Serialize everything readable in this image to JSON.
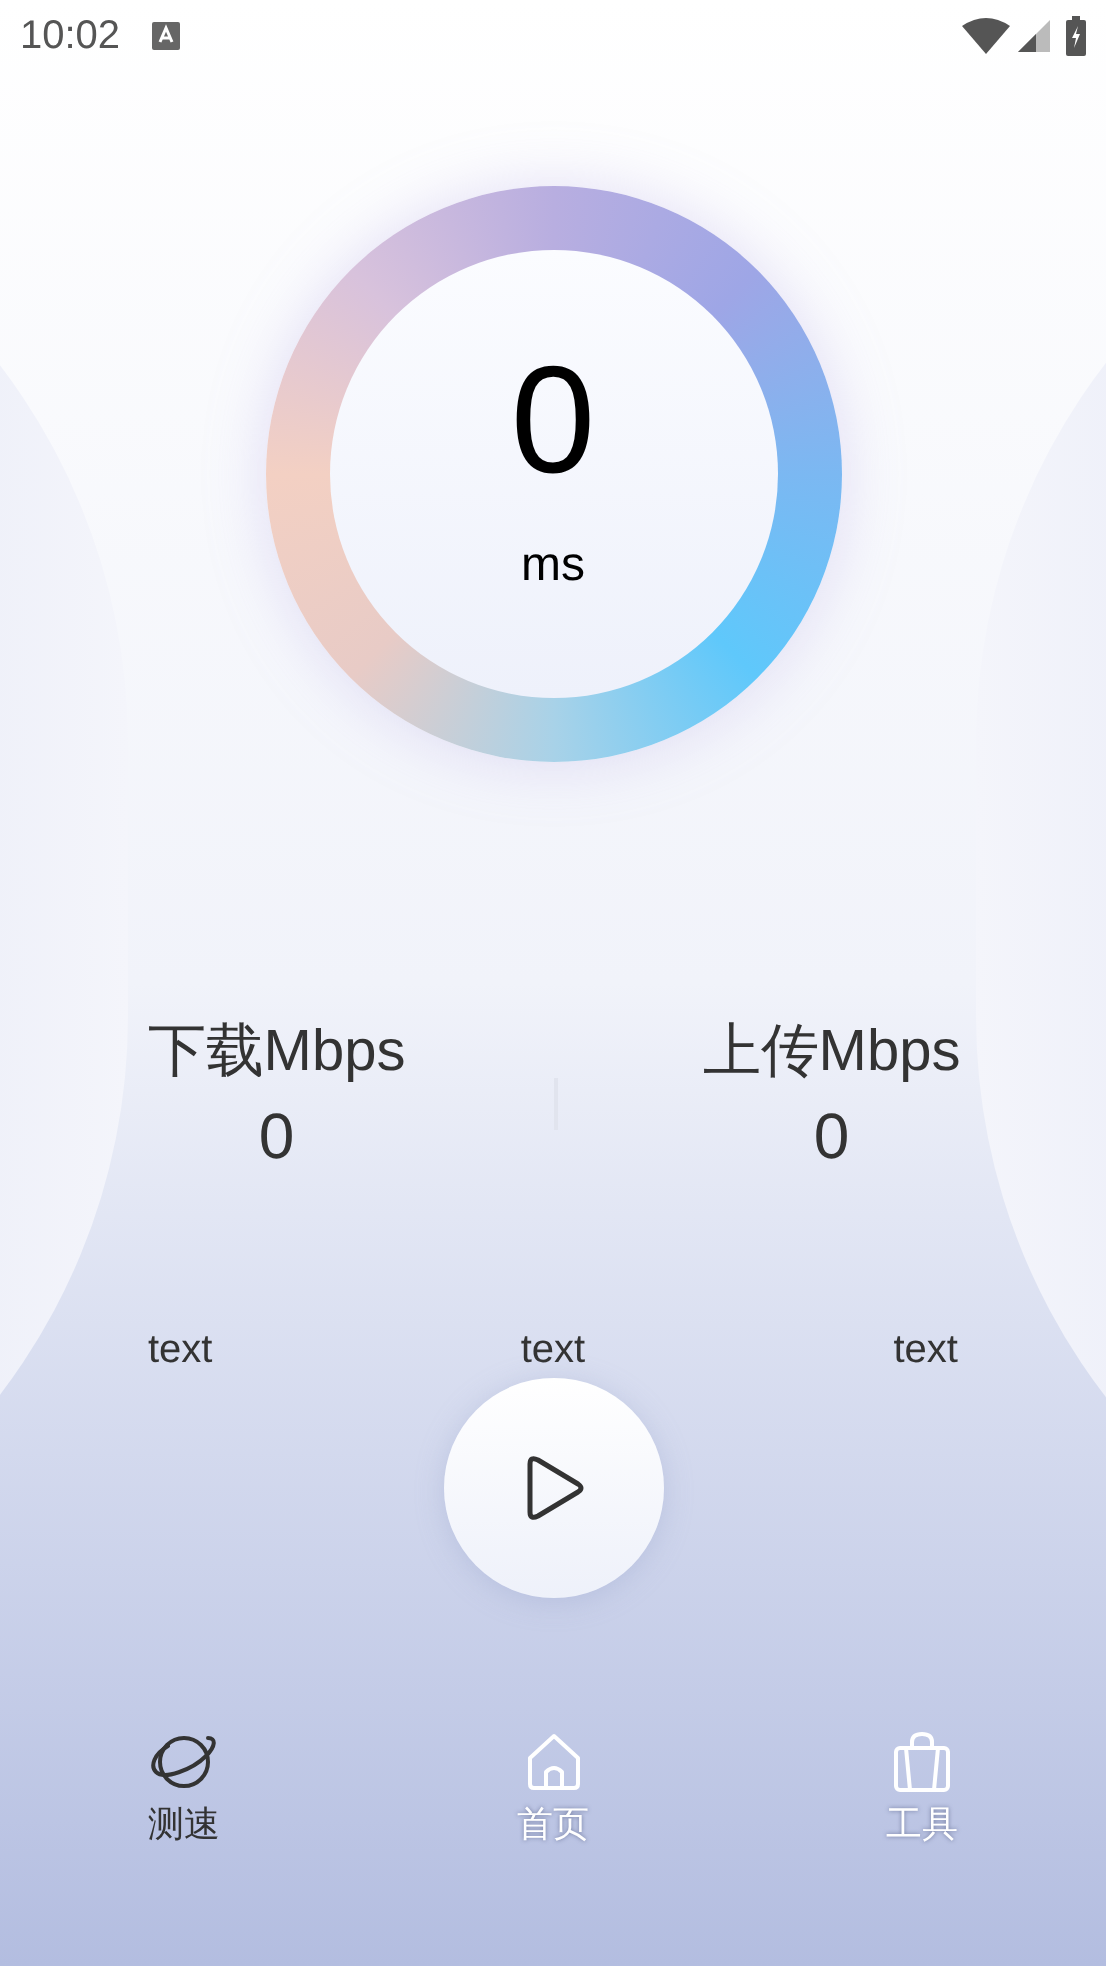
{
  "status_bar": {
    "time": "10:02"
  },
  "gauge": {
    "value": "0",
    "unit": "ms"
  },
  "stats": [
    {
      "label": "下载Mbps",
      "value": "0"
    },
    {
      "label": "上传Mbps",
      "value": "0"
    }
  ],
  "info_labels": [
    "text",
    "text",
    "text"
  ],
  "nav": [
    {
      "label": "测速",
      "kind": "planet",
      "selected": true
    },
    {
      "label": "首页",
      "kind": "home",
      "selected": false
    },
    {
      "label": "工具",
      "kind": "bag",
      "selected": false
    }
  ]
}
